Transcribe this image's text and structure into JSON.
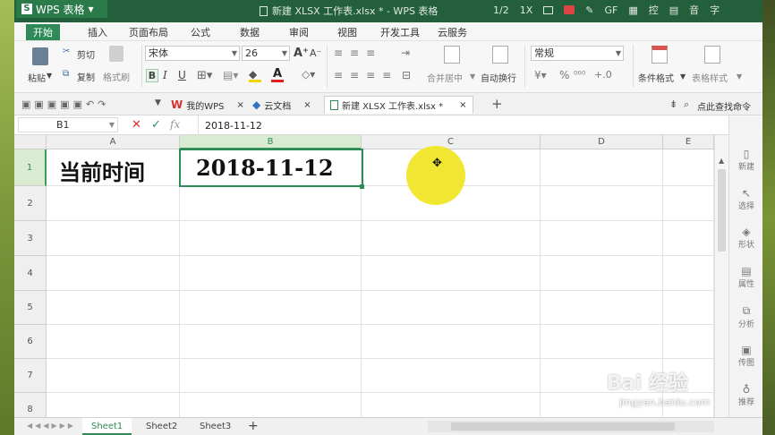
{
  "app": {
    "name": "WPS 表格"
  },
  "window": {
    "title": "新建 XLSX 工作表.xlsx * - WPS 表格",
    "page_counter": "1/2",
    "x_label": "1X",
    "gf_label": "GF"
  },
  "menu": {
    "items": [
      "开始",
      "插入",
      "页面布局",
      "公式",
      "数据",
      "审阅",
      "视图",
      "开发工具",
      "云服务"
    ]
  },
  "ribbon": {
    "paste": "粘贴",
    "cut": "剪切",
    "copy": "复制",
    "format_painter": "格式刷",
    "font_name": "宋体",
    "font_size": "26",
    "merge_center": "合并居中",
    "wrap": "自动换行",
    "number_format": "常规",
    "percent": "%",
    "conditional_format": "条件格式",
    "table_style": "表格样式"
  },
  "tabs": {
    "mywps": "我的WPS",
    "cloud": "云文档",
    "doc": "新建 XLSX 工作表.xlsx *",
    "find_cmd": "点此查找命令"
  },
  "formula_bar": {
    "cell_ref": "B1",
    "fx": "fx",
    "value": "2018-11-12"
  },
  "grid": {
    "columns": [
      "A",
      "B",
      "C",
      "D",
      "E"
    ],
    "rows": [
      "1",
      "2",
      "3",
      "4",
      "5",
      "6",
      "7",
      "8"
    ],
    "cells": {
      "A1": "当前时间",
      "B1": "2018-11-12"
    }
  },
  "sidebar": {
    "items": [
      "新建",
      "选择",
      "形状",
      "属性",
      "分析",
      "传图",
      "推荐"
    ]
  },
  "sheets": {
    "tabs": [
      "Sheet1",
      "Sheet2",
      "Sheet3"
    ],
    "add": "+"
  },
  "watermark": {
    "brand": "Bai 经验",
    "url": "jingyan.baidu.com"
  },
  "colors": {
    "accent": "#2e8b57",
    "title_bar": "#245f3c",
    "cursor_highlight": "#f0e628"
  }
}
